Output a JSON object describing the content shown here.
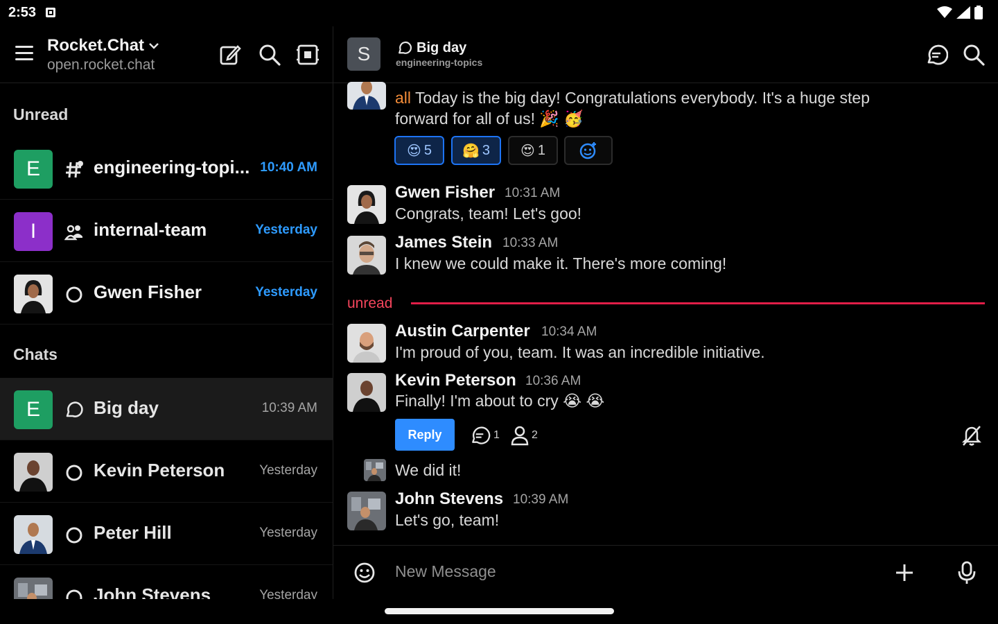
{
  "status_bar": {
    "time": "2:53"
  },
  "sidebar": {
    "workspace_name": "Rocket.Chat",
    "workspace_url": "open.rocket.chat",
    "sections": {
      "unread": "Unread",
      "chats": "Chats"
    },
    "unread_rooms": [
      {
        "initial": "E",
        "avatar_color": "#1e9e62",
        "name": "engineering-topi...",
        "time": "10:40 AM",
        "icon": "channel-icon"
      },
      {
        "initial": "I",
        "avatar_color": "#8c2fc9",
        "name": "internal-team",
        "time": "Yesterday",
        "icon": "team-icon"
      },
      {
        "initial": "",
        "name": "Gwen Fisher",
        "time": "Yesterday",
        "icon": "status-offline-icon"
      }
    ],
    "chat_rooms": [
      {
        "initial": "E",
        "avatar_color": "#1e9e62",
        "name": "Big day",
        "time": "10:39 AM",
        "icon": "discussion-icon"
      },
      {
        "initial": "",
        "name": "Kevin Peterson",
        "time": "Yesterday",
        "icon": "status-offline-icon"
      },
      {
        "initial": "",
        "name": "Peter Hill",
        "time": "Yesterday",
        "icon": "status-offline-icon"
      },
      {
        "initial": "",
        "name": "John Stevens",
        "time": "Yesterday",
        "icon": "status-offline-icon"
      }
    ]
  },
  "room": {
    "avatar_initial": "S",
    "title": "Big day",
    "subtitle": "engineering-topics"
  },
  "messages": {
    "first": {
      "mention": "all",
      "text_line1": " Today is the big day! Congratulations everybody. It's a huge step",
      "text_line2": "forward for all of us! 🎉 🥳"
    },
    "reactions": [
      {
        "emoji": "😍",
        "count": "5"
      },
      {
        "emoji": "🤗",
        "count": "3"
      },
      {
        "emoji": "😍",
        "count": "1"
      }
    ],
    "gwen": {
      "name": "Gwen Fisher",
      "time": "10:31 AM",
      "text": "Congrats, team! Let's goo!"
    },
    "james": {
      "name": "James Stein",
      "time": "10:33 AM",
      "text": "I knew we could make it. There's more coming!"
    },
    "unread_label": "unread",
    "austin": {
      "name": "Austin Carpenter",
      "time": "10:34 AM",
      "text": "I'm proud of you, team. It was an incredible initiative."
    },
    "kevin": {
      "name": "Kevin Peterson",
      "time": "10:36 AM",
      "text": "Finally! I'm about to cry 😭 😭"
    },
    "thread": {
      "reply_label": "Reply",
      "replies_count": "1",
      "participants_count": "2"
    },
    "kevin_followup": {
      "text": "We did it!"
    },
    "john": {
      "name": "John Stevens",
      "time": "10:39 AM",
      "text": "Let's go, team!"
    }
  },
  "composer": {
    "placeholder": "New Message"
  }
}
